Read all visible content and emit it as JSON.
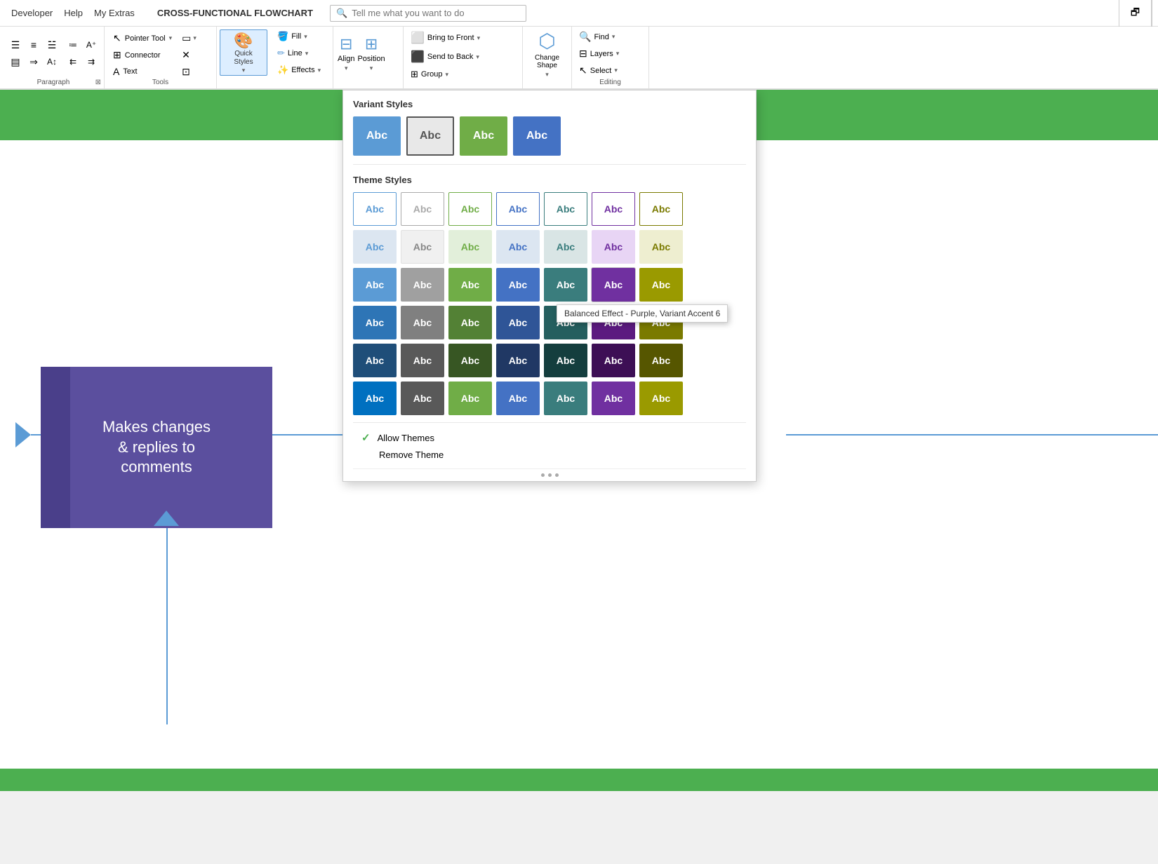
{
  "window": {
    "menu_items": [
      "Developer",
      "Help",
      "My Extras"
    ],
    "doc_title": "CROSS-FUNCTIONAL FLOWCHART",
    "search_placeholder": "Tell me what you want to do"
  },
  "ribbon": {
    "paragraph_group_label": "Paragraph",
    "tools_group_label": "Tools",
    "quick_styles_label": "Quick\nStyles",
    "format_group_label": "",
    "arrange_group_label": "",
    "editing_group_label": "Editing",
    "pointer_tool": "Pointer Tool",
    "connector": "Connector",
    "text": "Text",
    "fill_label": "Fill",
    "line_label": "Line",
    "effects_label": "Effects",
    "align_label": "Align",
    "position_label": "Position",
    "bring_to_front": "Bring to Front",
    "send_to_back": "Send to Back",
    "group_label": "Group",
    "change_shape": "Change\nShape",
    "find_label": "Find",
    "layers_label": "Layers",
    "select_label": "Select"
  },
  "dropdown": {
    "title_variant": "Variant Styles",
    "title_theme": "Theme Styles",
    "variant_swatches": [
      {
        "label": "Abc",
        "style": "var-blue",
        "selected": false
      },
      {
        "label": "Abc",
        "style": "var-gray",
        "selected": true
      },
      {
        "label": "Abc",
        "style": "var-green",
        "selected": false
      },
      {
        "label": "Abc",
        "style": "var-dark-blue",
        "selected": false
      }
    ],
    "theme_rows": [
      [
        "ts-r1-c1",
        "ts-r1-c2",
        "ts-r1-c3",
        "ts-r1-c4",
        "ts-r1-c5",
        "ts-r1-c6",
        "ts-r1-c7"
      ],
      [
        "ts-r2-c1",
        "ts-r2-c2",
        "ts-r2-c3",
        "ts-r2-c4",
        "ts-r2-c5",
        "ts-r2-c6",
        "ts-r2-c7"
      ],
      [
        "ts-r3-c1",
        "ts-r3-c2",
        "ts-r3-c3",
        "ts-r3-c4",
        "ts-r3-c5",
        "ts-r3-c6",
        "ts-r3-c7"
      ],
      [
        "ts-r4-c1",
        "ts-r4-c2",
        "ts-r4-c3",
        "ts-r4-c4",
        "ts-r4-c5",
        "ts-r4-c6",
        "ts-r4-c7"
      ],
      [
        "ts-r5-c1",
        "ts-r5-c2",
        "ts-r5-c3",
        "ts-r5-c4",
        "ts-r5-c5",
        "ts-r5-c6",
        "ts-r5-c7"
      ],
      [
        "ts-r6-c1",
        "ts-r6-c2",
        "ts-r6-c3",
        "ts-r6-c4",
        "ts-r6-c5",
        "ts-r6-c6",
        "ts-r6-c7"
      ]
    ],
    "swatch_label": "Abc",
    "allow_themes_label": "Allow Themes",
    "remove_theme_label": "Remove Theme",
    "tooltip_text": "Balanced Effect - Purple, Variant Accent 6",
    "tooltip_row": 2,
    "tooltip_col": 5
  },
  "canvas": {
    "swimlane_header_color": "#4caf50",
    "shape_text": "Makes changes\n& replies to\ncomments",
    "shape_color": "#5b4f9e"
  }
}
